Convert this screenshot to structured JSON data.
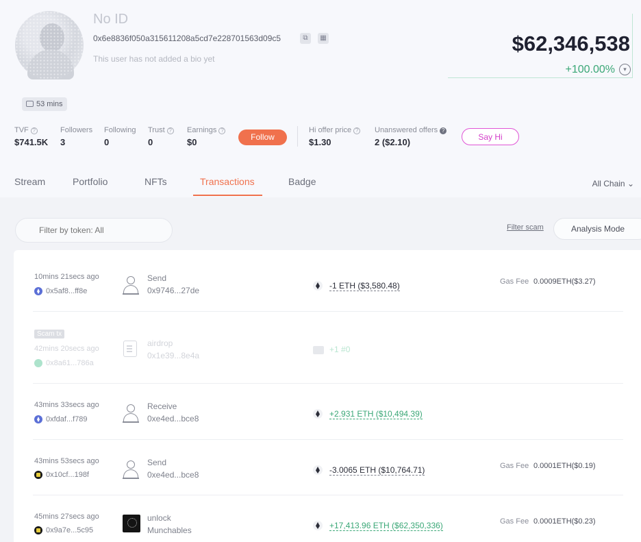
{
  "profile": {
    "name": "No ID",
    "address": "0x6e8836f050a315611208a5cd7e228701563d09c5",
    "bio": "This user has not added a bio yet",
    "net_worth": "$62,346,538",
    "net_worth_change": "+100.00%",
    "last_active": "53 mins"
  },
  "stats": {
    "tvf": {
      "label": "TVF",
      "value": "$741.5K"
    },
    "followers": {
      "label": "Followers",
      "value": "3"
    },
    "following": {
      "label": "Following",
      "value": "0"
    },
    "trust": {
      "label": "Trust",
      "value": "0"
    },
    "earnings": {
      "label": "Earnings",
      "value": "$0"
    },
    "hi_offer": {
      "label": "Hi offer price",
      "value": "$1.30"
    },
    "unanswered": {
      "label": "Unanswered offers",
      "value": "2 ($2.10)"
    }
  },
  "buttons": {
    "follow": "Follow",
    "say_hi": "Say Hi",
    "analysis_mode": "Analysis Mode",
    "filter_scam": "Filter scam"
  },
  "tabs": [
    "Stream",
    "Portfolio",
    "NFTs",
    "Transactions",
    "Badge"
  ],
  "active_tab": "Transactions",
  "chain_filter": "All Chain",
  "search": {
    "placeholder": "Filter by token: All"
  },
  "transactions": [
    {
      "time": "10mins 21secs ago",
      "hash": "0x5af8...ff8e",
      "chain": "eth",
      "action": "Send",
      "counterparty": "0x9746...27de",
      "amount": "-1 ETH ($3,580.48)",
      "direction": "out",
      "gas_label": "Gas Fee",
      "gas": "0.0009ETH($3.27)"
    },
    {
      "scam_badge": "Scam tx",
      "time": "42mins 20secs ago",
      "hash": "0x8a61...786a",
      "chain": "green",
      "action": "airdrop",
      "counterparty": "0x1e39...8e4a",
      "amount": "+1 #0",
      "direction": "in"
    },
    {
      "time": "43mins 33secs ago",
      "hash": "0xfdaf...f789",
      "chain": "eth",
      "action": "Receive",
      "counterparty": "0xe4ed...bce8",
      "amount": "+2.931 ETH ($10,494.39)",
      "direction": "in"
    },
    {
      "time": "43mins 53secs ago",
      "hash": "0x10cf...198f",
      "chain": "blast",
      "action": "Send",
      "counterparty": "0xe4ed...bce8",
      "amount": "-3.0065 ETH ($10,764.71)",
      "direction": "out",
      "gas_label": "Gas Fee",
      "gas": "0.0001ETH($0.19)"
    },
    {
      "time": "45mins 27secs ago",
      "hash": "0x9a7e...5c95",
      "chain": "blast",
      "action": "unlock",
      "counterparty": "Munchables",
      "amount": "+17,413.96 ETH ($62,350,336)",
      "direction": "in",
      "gas_label": "Gas Fee",
      "gas": "0.0001ETH($0.23)"
    }
  ],
  "colors": {
    "accent": "#f0714d",
    "positive": "#3aa776",
    "say_hi": "#d43fca"
  }
}
